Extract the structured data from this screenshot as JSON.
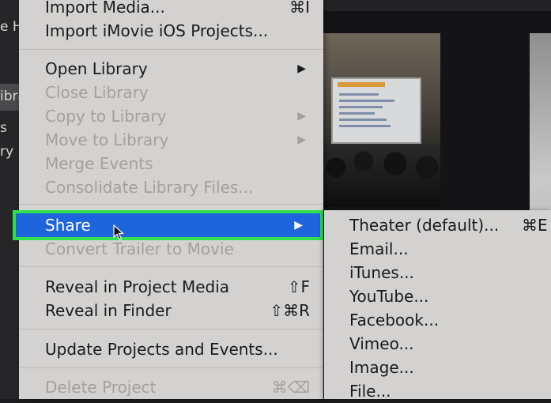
{
  "sidebar_fragments": [
    "e H",
    "ibra",
    "s",
    "ry"
  ],
  "menu": {
    "items": [
      {
        "label": "Import Media...",
        "shortcut": "⌘I",
        "disabled": false
      },
      {
        "label": "Import iMovie iOS Projects...",
        "shortcut": "",
        "disabled": false
      },
      {
        "label": "Open Library",
        "shortcut": "▶",
        "disabled": false
      },
      {
        "label": "Close Library",
        "shortcut": "",
        "disabled": true
      },
      {
        "label": "Copy to Library",
        "shortcut": "▶",
        "disabled": true
      },
      {
        "label": "Move to Library",
        "shortcut": "▶",
        "disabled": true
      },
      {
        "label": "Merge Events",
        "shortcut": "",
        "disabled": true
      },
      {
        "label": "Consolidate Library Files...",
        "shortcut": "",
        "disabled": true
      },
      {
        "label": "Share",
        "shortcut": "▶",
        "disabled": false,
        "highlighted": true
      },
      {
        "label": "Convert Trailer to Movie",
        "shortcut": "",
        "disabled": true
      },
      {
        "label": "Reveal in Project Media",
        "shortcut": "⇧F",
        "disabled": false
      },
      {
        "label": "Reveal in Finder",
        "shortcut": "⇧⌘R",
        "disabled": false
      },
      {
        "label": "Update Projects and Events...",
        "shortcut": "",
        "disabled": false
      },
      {
        "label": "Delete Project",
        "shortcut": "⌘⌫",
        "disabled": true
      }
    ]
  },
  "share_submenu": {
    "items": [
      {
        "label": "Theater (default)...",
        "shortcut": "⌘E"
      },
      {
        "label": "Email..."
      },
      {
        "label": "iTunes..."
      },
      {
        "label": "YouTube..."
      },
      {
        "label": "Facebook..."
      },
      {
        "label": "Vimeo..."
      },
      {
        "label": "Image..."
      },
      {
        "label": "File..."
      }
    ]
  },
  "colors": {
    "menu_bg": "#d4d2d0",
    "highlight": "#1e64dd",
    "annotation_outline": "#2ee04a",
    "disabled_text": "#a3a19f"
  }
}
